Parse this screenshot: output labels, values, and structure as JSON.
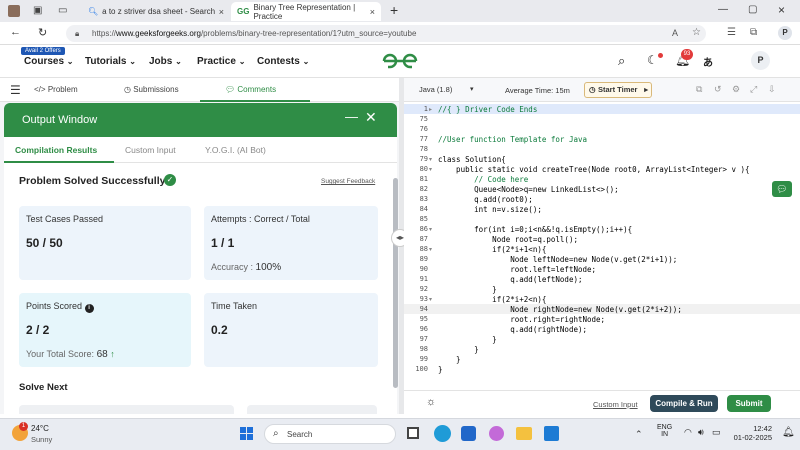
{
  "browser": {
    "tabs": [
      {
        "title": "a to z striver dsa sheet - Search",
        "active": false
      },
      {
        "title": "Binary Tree Representation | Practice",
        "active": true
      }
    ],
    "url_prefix": "https://",
    "url_host": "www.geeksforgeeks.org",
    "url_path": "/problems/binary-tree-representation/1?utm_source=youtube",
    "new_tab": "+",
    "close": "×"
  },
  "site": {
    "offer_badge": "Avail 2 Offers",
    "nav": [
      "Courses",
      "Tutorials",
      "Jobs",
      "Practice",
      "Contests"
    ],
    "logo": "GfG",
    "notif_count": "93",
    "avatar": "P"
  },
  "left": {
    "subtabs": [
      "Problem",
      "Submissions",
      "Comments"
    ],
    "output_title": "Output Window",
    "result_tabs": [
      "Compilation Results",
      "Custom Input",
      "Y.O.G.I. (AI Bot)"
    ],
    "status": "Problem Solved Successfully",
    "suggest": "Suggest Feedback",
    "cards": {
      "tests_label": "Test Cases Passed",
      "tests_value": "50 / 50",
      "attempts_label": "Attempts : Correct / Total",
      "attempts_value": "1 / 1",
      "accuracy_label": "Accuracy :",
      "accuracy_value": "100%",
      "points_label": "Points Scored",
      "points_value": "2 / 2",
      "total_label": "Your Total Score:",
      "total_value": "68",
      "time_label": "Time Taken",
      "time_value": "0.2"
    },
    "solve_next": "Solve Next"
  },
  "editor": {
    "language": "Java (1.8)",
    "avg_time": "Average Time: 15m",
    "start_timer": "Start Timer",
    "lines": [
      {
        "n": "1",
        "t": "//{ } Driver Code Ends",
        "c": "#0a7a3a",
        "fold": "▸",
        "hl": true
      },
      {
        "n": "75",
        "t": ""
      },
      {
        "n": "76",
        "t": ""
      },
      {
        "n": "77",
        "t": "//User function Template for Java",
        "c": "#0a7a3a"
      },
      {
        "n": "78",
        "t": ""
      },
      {
        "n": "79",
        "t": "class Solution{",
        "fold": "▾"
      },
      {
        "n": "80",
        "t": "    public static void createTree(Node root0, ArrayList<Integer> v ){",
        "fold": "▾"
      },
      {
        "n": "81",
        "t": "        // Code here",
        "c": "#0a7a3a"
      },
      {
        "n": "82",
        "t": "        Queue<Node>q=new LinkedList<>();"
      },
      {
        "n": "83",
        "t": "        q.add(root0);"
      },
      {
        "n": "84",
        "t": "        int n=v.size();"
      },
      {
        "n": "85",
        "t": ""
      },
      {
        "n": "86",
        "t": "        for(int i=0;i<n&&!q.isEmpty();i++){",
        "fold": "▾"
      },
      {
        "n": "87",
        "t": "            Node root=q.poll();"
      },
      {
        "n": "88",
        "t": "            if(2*i+1<n){",
        "fold": "▾"
      },
      {
        "n": "89",
        "t": "                Node leftNode=new Node(v.get(2*i+1));"
      },
      {
        "n": "90",
        "t": "                root.left=leftNode;"
      },
      {
        "n": "91",
        "t": "                q.add(leftNode);"
      },
      {
        "n": "92",
        "t": "            }"
      },
      {
        "n": "93",
        "t": "            if(2*i+2<n){",
        "fold": "▾"
      },
      {
        "n": "94",
        "t": "                Node rightNode=new Node(v.get(2*i+2));",
        "cur": true
      },
      {
        "n": "95",
        "t": "                root.right=rightNode;"
      },
      {
        "n": "96",
        "t": "                q.add(rightNode);"
      },
      {
        "n": "97",
        "t": "            }"
      },
      {
        "n": "98",
        "t": "        }"
      },
      {
        "n": "99",
        "t": "    }"
      },
      {
        "n": "100",
        "t": "}"
      }
    ],
    "custom_input": "Custom Input",
    "compile": "Compile & Run",
    "submit": "Submit"
  },
  "taskbar": {
    "weather_temp": "24°C",
    "weather_text": "Sunny",
    "weather_badge": "1",
    "search": "Search",
    "lang1": "ENG",
    "lang2": "IN",
    "time": "12:42",
    "date": "01-02-2025"
  },
  "colors": {
    "accent": "#2f8d46",
    "submit": "#2f8d46",
    "compile": "#2f4a5a"
  }
}
